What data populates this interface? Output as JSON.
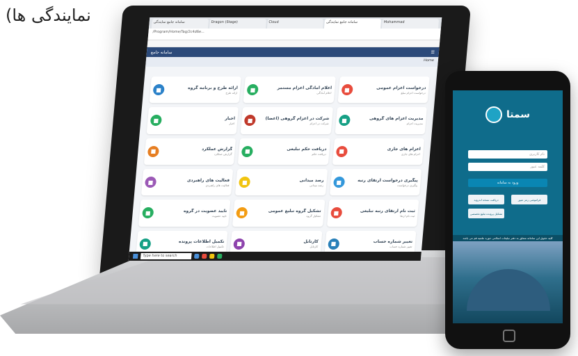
{
  "heading_text": "نمایندگی ها)",
  "browser": {
    "tabs": [
      "سامانه جامع نمایندگی",
      "Dragon (Stage)",
      "Cloud",
      "سامانه جامع نمایندگی",
      "Mohammad"
    ],
    "address": "/Program/Home/Tag/2c4d6e..."
  },
  "app": {
    "brand": "سامانه جامع",
    "section": "Home"
  },
  "cards": [
    {
      "title": "درخواست اعزام عمومی",
      "sub": "درخواست اعزام مبلغ",
      "color": "#e84c3d"
    },
    {
      "title": "اعلام آمادگی اعزام مستمر",
      "sub": "اعلام آمادگی",
      "color": "#27ae60"
    },
    {
      "title": "ارائه طرح و برنامه گروه",
      "sub": "ارائه طرح",
      "color": "#2c82c9"
    },
    {
      "title": "مدیریت اعزام های گروهی",
      "sub": "مدیریت اعزام",
      "color": "#16a085"
    },
    {
      "title": "شرکت در اعزام گروهی (اعضا)",
      "sub": "شرکت در اعزام",
      "color": "#c0392b"
    },
    {
      "title": "اخبار",
      "sub": "اخبار",
      "color": "#27ae60"
    },
    {
      "title": "اعزام های جاری",
      "sub": "اعزام های جاری",
      "color": "#e84c3d"
    },
    {
      "title": "دریافت حکم تبلیغی",
      "sub": "دریافت حکم",
      "color": "#27ae60"
    },
    {
      "title": "گزارش عملکرد",
      "sub": "گزارش عملکرد",
      "color": "#e67e22"
    },
    {
      "title": "پیگیری درخواست ارتقای رتبه",
      "sub": "پیگیری درخواست",
      "color": "#3498db"
    },
    {
      "title": "رصد میدانی",
      "sub": "رصد میدانی",
      "color": "#f1c40f"
    },
    {
      "title": "فعالیت های راهبردی",
      "sub": "فعالیت های راهبردی",
      "color": "#9b59b6"
    },
    {
      "title": "ثبت نام ارتقای رتبه تبلیغی",
      "sub": "ثبت نام ارتقا",
      "color": "#e84c3d"
    },
    {
      "title": "تشکیل گروه تبلیغ عمومی",
      "sub": "تشکیل گروه",
      "color": "#f39c12"
    },
    {
      "title": "تایید عضویت در گروه",
      "sub": "تایید عضویت",
      "color": "#27ae60"
    },
    {
      "title": "تغییر شماره حساب",
      "sub": "تغییر شماره حساب",
      "color": "#2980b9"
    },
    {
      "title": "کارتابل",
      "sub": "کارتابل",
      "color": "#8e44ad"
    },
    {
      "title": "تکمیل اطلاعات پرونده",
      "sub": "تکمیل اطلاعات",
      "color": "#16a085"
    }
  ],
  "taskbar": {
    "search_placeholder": "Type here to search"
  },
  "phone": {
    "brand": "سمتا",
    "username_placeholder": "نام کاربری",
    "password_placeholder": "کلمه عبور",
    "login_label": "ورود به سامانه",
    "forgot_label": "فراموشی رمز عبور",
    "download_label": "دریافت نسخه اندروید",
    "file_label": "تشکیل پرونده تبلیغ تخصصی",
    "banner": "کلیه حقوق این سامانه متعلق به دفتر تبلیغات اسلامی حوزه علمیه قم می باشد"
  }
}
